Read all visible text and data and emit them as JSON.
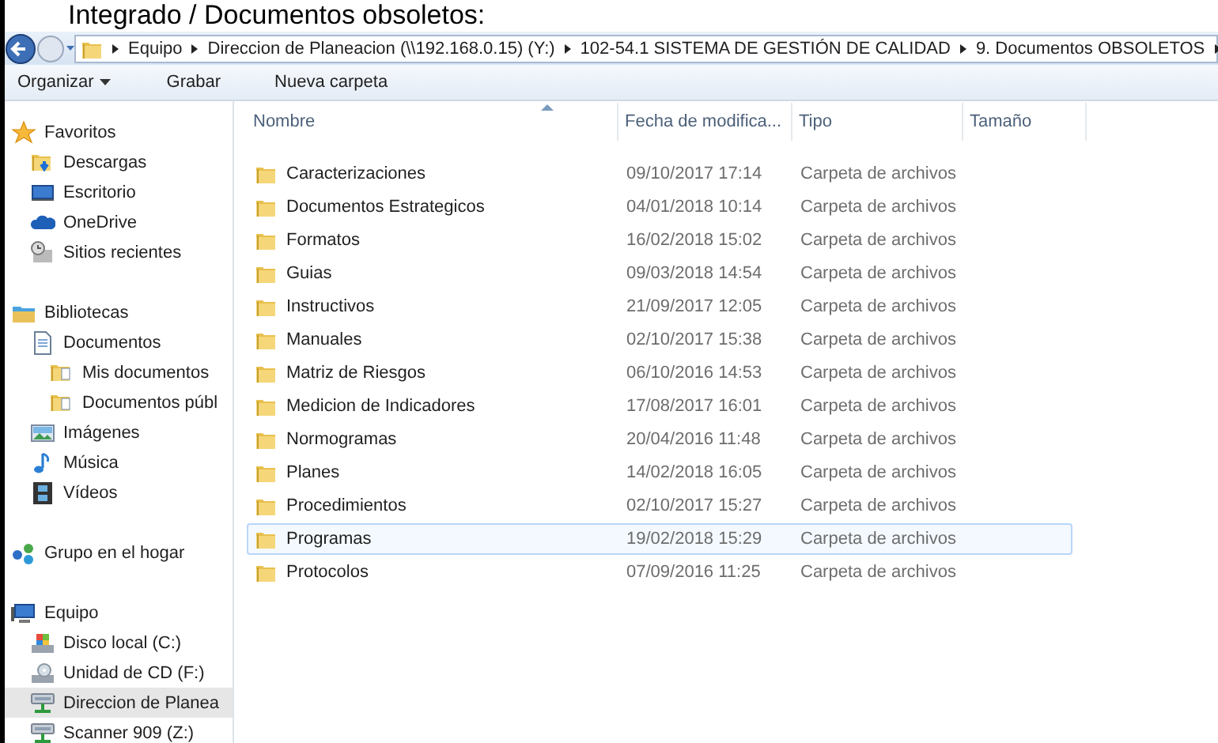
{
  "caption": "Integrado / Documentos obsoletos:",
  "address_bar": {
    "segments": [
      "Equipo",
      "Direccion de Planeacion (\\\\192.168.0.15) (Y:)",
      "102-54.1 SISTEMA DE GESTIÓN DE CALIDAD",
      "9. Documentos OBSOLETOS"
    ]
  },
  "toolbar": [
    {
      "label": "Organizar",
      "kind": "menu"
    },
    {
      "label": "Grabar",
      "kind": "button"
    },
    {
      "label": "Nueva carpeta",
      "kind": "button"
    }
  ],
  "sidebar": {
    "groups": [
      {
        "label": "Favoritos",
        "kind": "star",
        "selected": false,
        "children": [
          {
            "label": "Descargas",
            "kind": "download",
            "selected": false
          },
          {
            "label": "Escritorio",
            "kind": "desktop",
            "selected": false
          },
          {
            "label": "OneDrive",
            "kind": "cloud",
            "selected": false
          },
          {
            "label": "Sitios recientes",
            "kind": "recent",
            "selected": false
          }
        ]
      },
      {
        "label": "Bibliotecas",
        "kind": "library",
        "selected": false,
        "children": [
          {
            "label": "Documentos",
            "kind": "document",
            "selected": false,
            "children": [
              {
                "label": "Mis documentos",
                "kind": "docfolder",
                "selected": false
              },
              {
                "label": "Documentos públ",
                "kind": "docfolder",
                "selected": false
              }
            ]
          },
          {
            "label": "Imágenes",
            "kind": "pictures",
            "selected": false
          },
          {
            "label": "Música",
            "kind": "music",
            "selected": false
          },
          {
            "label": "Vídeos",
            "kind": "video",
            "selected": false
          }
        ]
      },
      {
        "label": "Grupo en el hogar",
        "kind": "homegroup",
        "selected": false
      },
      {
        "label": "Equipo",
        "kind": "computer",
        "selected": false,
        "children": [
          {
            "label": "Disco local (C:)",
            "kind": "disk",
            "selected": false
          },
          {
            "label": "Unidad de CD (F:)",
            "kind": "cd",
            "selected": false
          },
          {
            "label": "Direccion de Planea",
            "kind": "network",
            "selected": true
          },
          {
            "label": "Scanner 909 (Z:)",
            "kind": "network",
            "selected": false
          }
        ]
      }
    ]
  },
  "file_list": {
    "columns": [
      {
        "label": "Nombre",
        "sorted": true
      },
      {
        "label": "Fecha de modifica...",
        "sorted": false
      },
      {
        "label": "Tipo",
        "sorted": false
      },
      {
        "label": "Tamaño",
        "sorted": false
      }
    ],
    "rows": [
      {
        "name": "Caracterizaciones",
        "date": "09/10/2017 17:14",
        "type": "Carpeta de archivos",
        "selected": false
      },
      {
        "name": "Documentos Estrategicos",
        "date": "04/01/2018 10:14",
        "type": "Carpeta de archivos",
        "selected": false
      },
      {
        "name": "Formatos",
        "date": "16/02/2018 15:02",
        "type": "Carpeta de archivos",
        "selected": false
      },
      {
        "name": "Guias",
        "date": "09/03/2018 14:54",
        "type": "Carpeta de archivos",
        "selected": false
      },
      {
        "name": "Instructivos",
        "date": "21/09/2017 12:05",
        "type": "Carpeta de archivos",
        "selected": false
      },
      {
        "name": "Manuales",
        "date": "02/10/2017 15:38",
        "type": "Carpeta de archivos",
        "selected": false
      },
      {
        "name": "Matriz de Riesgos",
        "date": "06/10/2016 14:53",
        "type": "Carpeta de archivos",
        "selected": false
      },
      {
        "name": "Medicion de Indicadores",
        "date": "17/08/2017 16:01",
        "type": "Carpeta de archivos",
        "selected": false
      },
      {
        "name": "Normogramas",
        "date": "20/04/2016 11:48",
        "type": "Carpeta de archivos",
        "selected": false
      },
      {
        "name": "Planes",
        "date": "14/02/2018 16:05",
        "type": "Carpeta de archivos",
        "selected": false
      },
      {
        "name": "Procedimientos",
        "date": "02/10/2017 15:27",
        "type": "Carpeta de archivos",
        "selected": false
      },
      {
        "name": "Programas",
        "date": "19/02/2018 15:29",
        "type": "Carpeta de archivos",
        "selected": true
      },
      {
        "name": "Protocolos",
        "date": "07/09/2016 11:25",
        "type": "Carpeta de archivos",
        "selected": false
      }
    ]
  }
}
